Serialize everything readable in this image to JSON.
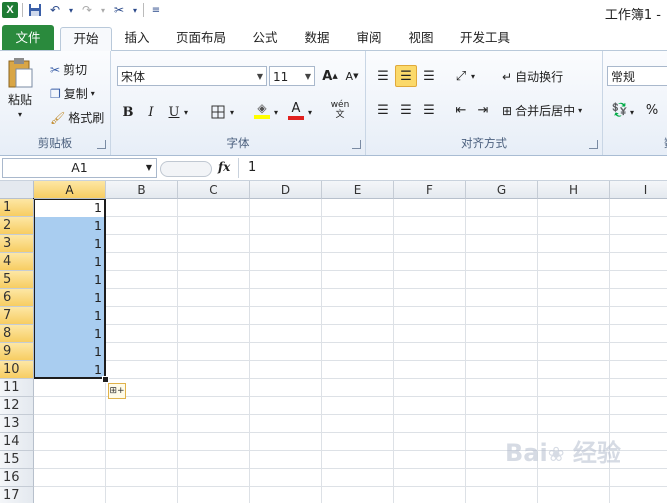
{
  "window": {
    "title": "工作簿1 -"
  },
  "tabs": [
    {
      "label": "文件"
    },
    {
      "label": "开始"
    },
    {
      "label": "插入"
    },
    {
      "label": "页面布局"
    },
    {
      "label": "公式"
    },
    {
      "label": "数据"
    },
    {
      "label": "审阅"
    },
    {
      "label": "视图"
    },
    {
      "label": "开发工具"
    }
  ],
  "clipboard": {
    "paste": "粘贴",
    "cut": "剪切",
    "copy": "复制",
    "format_painter": "格式刷",
    "label": "剪贴板"
  },
  "font": {
    "name": "宋体",
    "size": "11",
    "label": "字体",
    "bold": "B",
    "italic": "I",
    "underline": "U",
    "wen": "wén 文"
  },
  "alignment": {
    "wrap": "自动换行",
    "merge": "合并后居中",
    "label": "对齐方式"
  },
  "number": {
    "format": "常规",
    "label": "数字",
    "percent": "%"
  },
  "formula_bar": {
    "name_box": "A1",
    "fx": "fx",
    "value": "1"
  },
  "columns": [
    "A",
    "B",
    "C",
    "D",
    "E",
    "F",
    "G",
    "H",
    "I"
  ],
  "rows": [
    "1",
    "2",
    "3",
    "4",
    "5",
    "6",
    "7",
    "8",
    "9",
    "10",
    "11",
    "12",
    "13",
    "14",
    "15",
    "16",
    "17"
  ],
  "cells_A": [
    "1",
    "1",
    "1",
    "1",
    "1",
    "1",
    "1",
    "1",
    "1",
    "1"
  ],
  "colors": {
    "file_tab": "#2a8a3d",
    "selection": "#a9cdf0",
    "header_selected": "#f7cd62"
  }
}
